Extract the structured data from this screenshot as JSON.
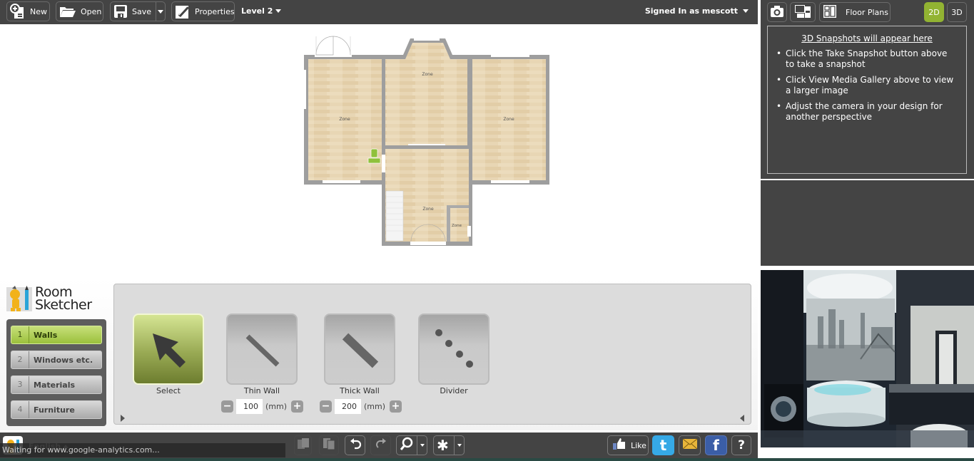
{
  "toolbar": {
    "new_label": "New",
    "open_label": "Open",
    "save_label": "Save",
    "properties_label": "Properties",
    "level_label": "Level 2",
    "signed_in_label": "Signed In as mescott"
  },
  "right_panel": {
    "floor_plans_label": "Floor Plans",
    "view_2d_label": "2D",
    "view_3d_label": "3D",
    "active_view": "2D",
    "snapshots_title": "3D Snapshots will appear here",
    "snapshot_tips": [
      "Click the Take Snapshot button above to take a snapshot",
      "Click View Media Gallery above to view a larger image",
      "Adjust the camera in your design for another perspective"
    ],
    "ad_image": "bathroom-interior-photo"
  },
  "floor_plan": {
    "zones": [
      {
        "name": "Zone",
        "room": "left-room"
      },
      {
        "name": "Zone",
        "room": "top-center-room"
      },
      {
        "name": "Zone",
        "room": "right-room"
      },
      {
        "name": "Zone",
        "room": "bottom-hall"
      },
      {
        "name": "Zone",
        "room": "small-closet"
      }
    ]
  },
  "logo": {
    "line1": "Room",
    "line2": "Sketcher"
  },
  "steps": [
    {
      "num": "1",
      "label": "Walls",
      "active": true
    },
    {
      "num": "2",
      "label": "Windows etc.",
      "active": false
    },
    {
      "num": "3",
      "label": "Materials",
      "active": false
    },
    {
      "num": "4",
      "label": "Furniture",
      "active": false
    }
  ],
  "tools": [
    {
      "label": "Select",
      "icon": "cursor-arrow-icon",
      "active": true
    },
    {
      "label": "Thin Wall",
      "icon": "thin-wall-icon",
      "active": false,
      "thickness": "100",
      "unit": "(mm)"
    },
    {
      "label": "Thick Wall",
      "icon": "thick-wall-icon",
      "active": false,
      "thickness": "200",
      "unit": "(mm)"
    },
    {
      "label": "Divider",
      "icon": "divider-dots-icon",
      "active": false
    }
  ],
  "bottom_bar": {
    "language": "English",
    "status_text": "Waiting for www.google-analytics.com...",
    "like_label": "Like",
    "help_label": "?"
  },
  "colors": {
    "toolbar_bg": "#444444",
    "accent_green": "#9bc03c",
    "floor_wood": "#e6d3b0",
    "wall_gray": "#9e9e9e"
  }
}
